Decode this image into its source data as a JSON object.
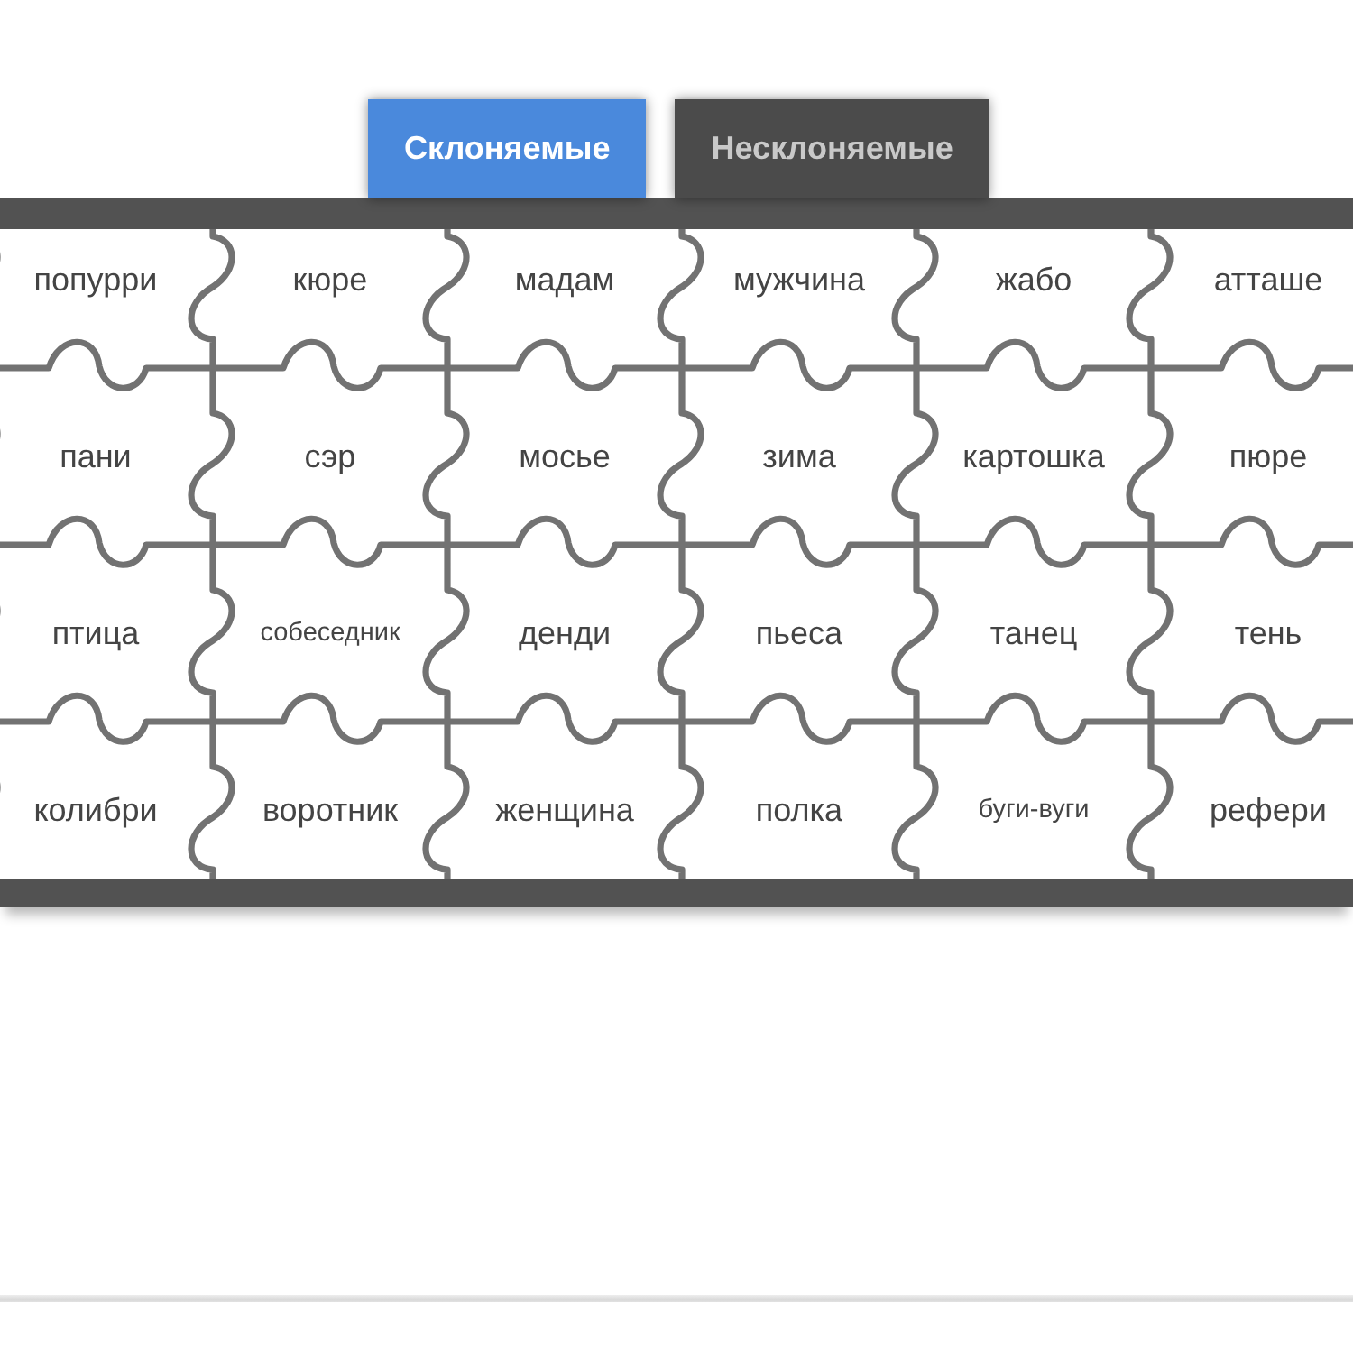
{
  "tabs": [
    {
      "label": "Склоняемые",
      "selected": true
    },
    {
      "label": "Несклоняемые",
      "selected": false
    }
  ],
  "puzzle": {
    "rows": [
      [
        "попурри",
        "кюре",
        "мадам",
        "мужчина",
        "жабо",
        "атташе"
      ],
      [
        "пани",
        "сэр",
        "мосье",
        "зима",
        "картошка",
        "пюре"
      ],
      [
        "птица",
        "собеседник",
        "денди",
        "пьеса",
        "танец",
        "тень"
      ],
      [
        "колибри",
        "воротник",
        "женщина",
        "полка",
        "буги-вуги",
        "рефери"
      ]
    ]
  }
}
